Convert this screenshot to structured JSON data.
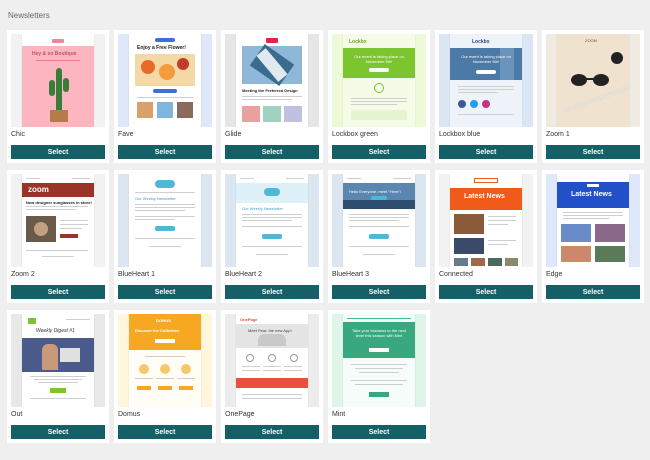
{
  "page": {
    "title": "Newsletters",
    "select_label": "Select"
  },
  "templates": [
    {
      "name": "Chic",
      "thumb": {
        "heading": "Hey & so Boutique"
      }
    },
    {
      "name": "Fave",
      "thumb": {
        "heading": "Enjoy a Free Flower!"
      }
    },
    {
      "name": "Glide",
      "thumb": {
        "heading": "Meeting the Preferred Design"
      }
    },
    {
      "name": "Lockbox green",
      "thumb": {
        "brand": "Lockbx",
        "heading": "Our event is taking place on November 5th!"
      }
    },
    {
      "name": "Lockbox blue",
      "thumb": {
        "brand": "Lockbx",
        "heading": "Our event is taking place on November 5th!"
      }
    },
    {
      "name": "Zoom 1",
      "thumb": {
        "brand": "ZOOM",
        "heading": "new designer sunglasses in store"
      }
    },
    {
      "name": "Zoom 2",
      "thumb": {
        "brand": "zoom",
        "heading": "New designer sunglasses in store!"
      }
    },
    {
      "name": "BlueHeart 1",
      "thumb": {
        "heading": "Our Weekly Newsletter"
      }
    },
    {
      "name": "BlueHeart 2",
      "thumb": {
        "heading": "Our Weekly Newsletter"
      }
    },
    {
      "name": "BlueHeart 3",
      "thumb": {
        "heading": "Hello Everyone, meet \"Here\"!"
      }
    },
    {
      "name": "Connected",
      "thumb": {
        "heading": "Latest News"
      }
    },
    {
      "name": "Edge",
      "thumb": {
        "heading": "Latest News"
      }
    },
    {
      "name": "Out",
      "thumb": {
        "heading": "Weekly Digest #1"
      }
    },
    {
      "name": "Domus",
      "thumb": {
        "brand": "DOMUS",
        "heading": "Discover the Collection"
      }
    },
    {
      "name": "OnePage",
      "thumb": {
        "brand": "OnePage",
        "heading": "Meet Pear, the new App!"
      }
    },
    {
      "name": "Mint",
      "thumb": {
        "heading": "Take your business to the next level this season with Mint"
      }
    }
  ]
}
